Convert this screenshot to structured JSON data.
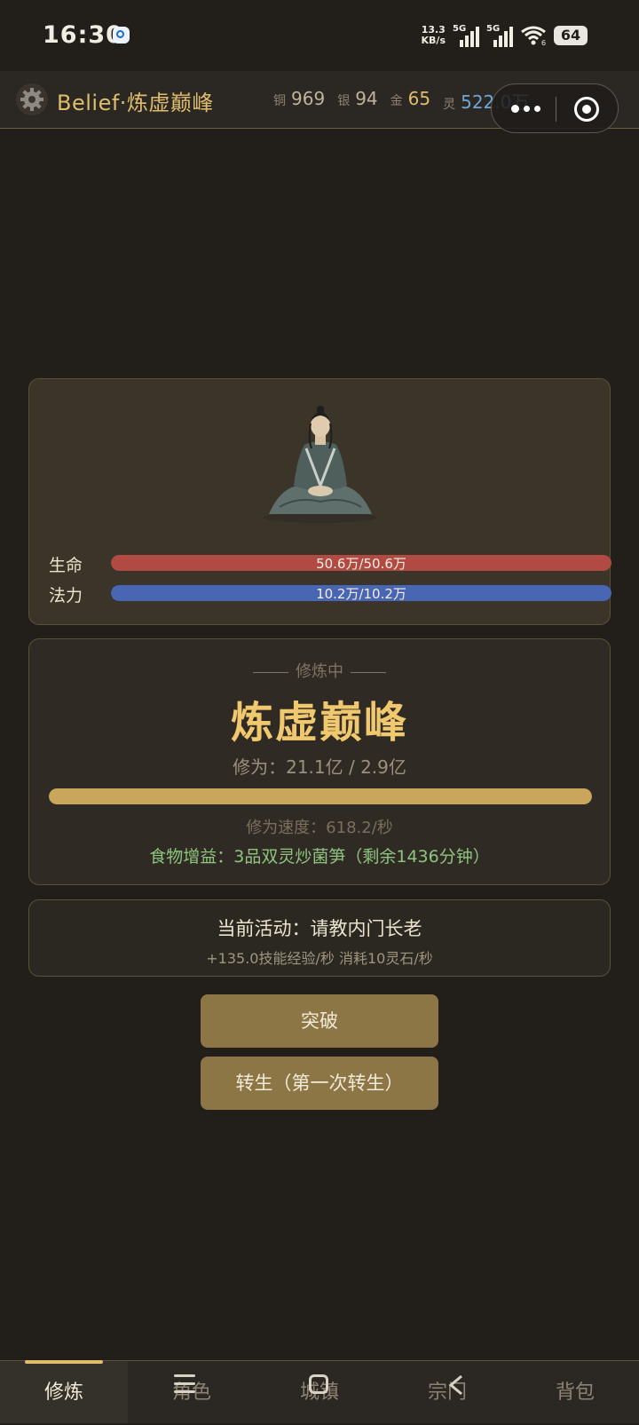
{
  "status_bar": {
    "time": "16:30",
    "net_speed_value": "13.3",
    "net_speed_unit": "KB/s",
    "signal1_label": "5G",
    "signal2_label": "5G",
    "wifi_sub": "6",
    "battery": "64"
  },
  "header": {
    "title": "Belief·炼虚巅峰",
    "currencies": [
      {
        "label": "铜",
        "value": "969"
      },
      {
        "label": "银",
        "value": "94"
      },
      {
        "label": "金",
        "value": "65"
      },
      {
        "label": "灵",
        "value": "522.0万"
      }
    ]
  },
  "character": {
    "hp_label": "生命",
    "hp_value": "50.6万/50.6万",
    "hp_ratio": 1.0,
    "mp_label": "法力",
    "mp_value": "10.2万/10.2万",
    "mp_ratio": 1.0
  },
  "cultivation": {
    "status": "修炼中",
    "realm": "炼虚巅峰",
    "xiuwei": "修为：21.1亿 / 2.9亿",
    "progress_ratio": 1.0,
    "speed": "修为速度：618.2/秒",
    "food": "食物增益：3品双灵炒菌笋（剩余1436分钟）"
  },
  "activity": {
    "title": "当前活动：请教内门长老",
    "detail": "+135.0技能经验/秒  消耗10灵石/秒"
  },
  "actions": {
    "breakthrough": "突破",
    "rebirth": "转生（第一次转生）"
  },
  "tabs": [
    {
      "label": "修炼",
      "active": true
    },
    {
      "label": "角色",
      "active": false
    },
    {
      "label": "城镇",
      "active": false
    },
    {
      "label": "宗门",
      "active": false
    },
    {
      "label": "背包",
      "active": false
    }
  ],
  "colors": {
    "accent_gold": "#e0bd6c",
    "hp_bar": "#b24a44",
    "mp_bar": "#4866b3",
    "food_green": "#8fc47f",
    "spirit_blue": "#6fa6d8"
  }
}
